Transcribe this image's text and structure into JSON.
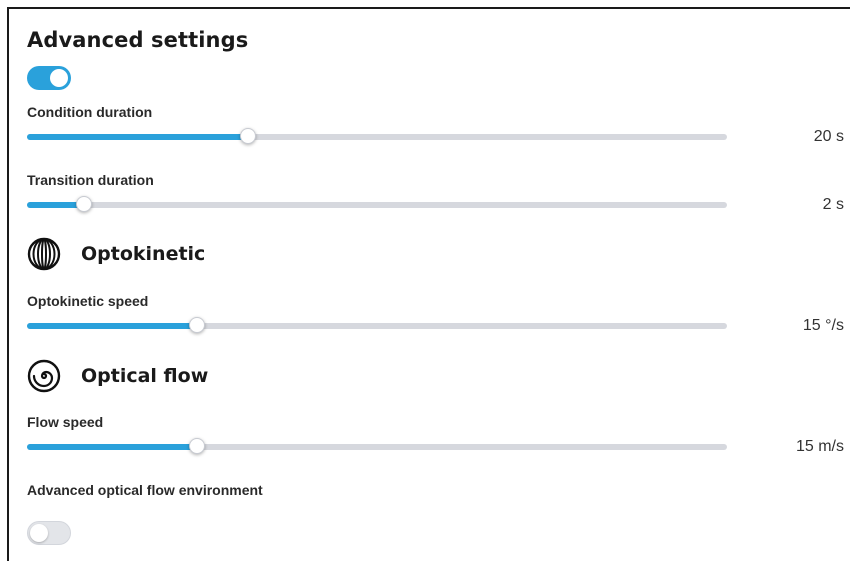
{
  "panel": {
    "title": "Advanced settings",
    "advanced_toggle_on": true
  },
  "condition_duration": {
    "label": "Condition duration",
    "value": "20 s",
    "fraction": 0.316
  },
  "transition_duration": {
    "label": "Transition duration",
    "value": "2 s",
    "fraction": 0.081
  },
  "optokinetic": {
    "title": "Optokinetic",
    "icon": "globe-meridians-icon",
    "speed": {
      "label": "Optokinetic speed",
      "value": "15 °/s",
      "fraction": 0.243
    }
  },
  "optical_flow": {
    "title": "Optical flow",
    "icon": "spiral-icon",
    "speed": {
      "label": "Flow speed",
      "value": "15 m/s",
      "fraction": 0.243
    },
    "environment_label": "Advanced optical flow environment",
    "environment_toggle_on": false
  },
  "colors": {
    "accent": "#2aa1db",
    "track": "#d6d8de"
  }
}
